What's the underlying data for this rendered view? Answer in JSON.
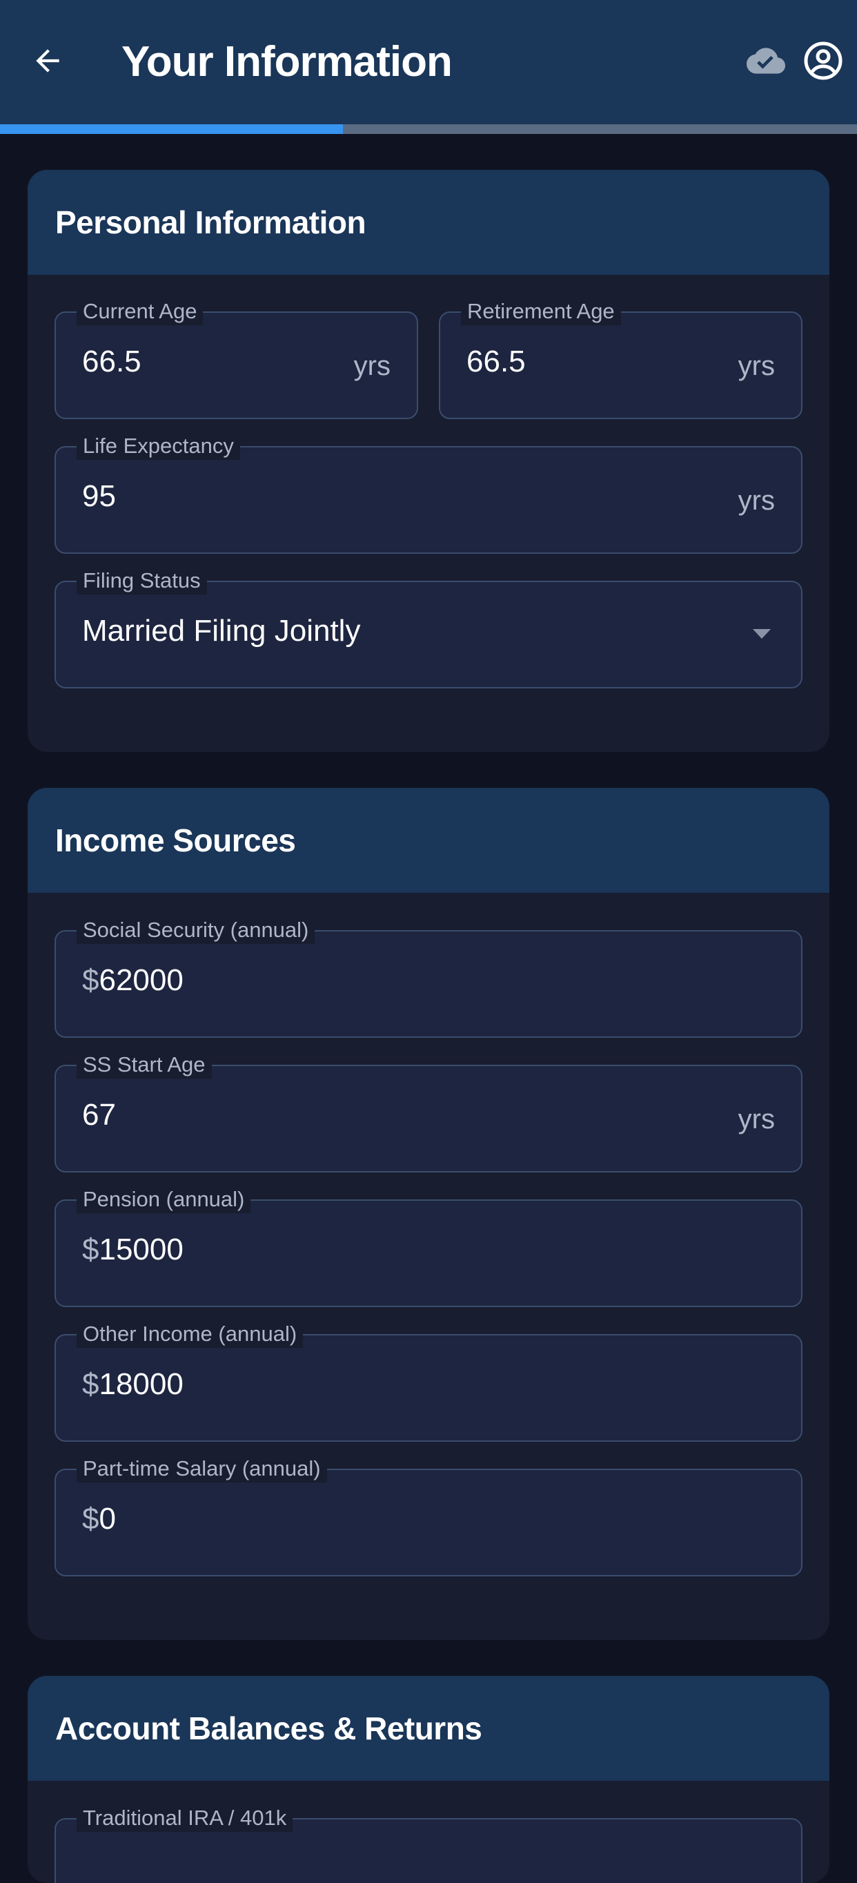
{
  "app": {
    "title": "Your Information",
    "progress_fraction": 0.4
  },
  "personal": {
    "title": "Personal Information",
    "current_age": {
      "label": "Current Age",
      "value": "66.5",
      "suffix": "yrs"
    },
    "retirement_age": {
      "label": "Retirement Age",
      "value": "66.5",
      "suffix": "yrs"
    },
    "life_expectancy": {
      "label": "Life Expectancy",
      "value": "95",
      "suffix": "yrs"
    },
    "filing_status": {
      "label": "Filing Status",
      "value": "Married Filing Jointly"
    }
  },
  "income": {
    "title": "Income Sources",
    "social_security": {
      "label": "Social Security (annual)",
      "prefix": "$",
      "value": "62000"
    },
    "ss_start_age": {
      "label": "SS Start Age",
      "value": "67",
      "suffix": "yrs"
    },
    "pension": {
      "label": "Pension (annual)",
      "prefix": "$",
      "value": "15000"
    },
    "other_income": {
      "label": "Other Income (annual)",
      "prefix": "$",
      "value": "18000"
    },
    "part_time_salary": {
      "label": "Part-time Salary (annual)",
      "prefix": "$",
      "value": "0"
    }
  },
  "accounts": {
    "title": "Account Balances & Returns",
    "traditional_ira": {
      "label": "Traditional IRA / 401k"
    }
  },
  "icons": {
    "back": "arrow-back-icon",
    "cloud": "cloud-done-icon",
    "account": "account-circle-icon",
    "dropdown": "dropdown-arrow-icon"
  },
  "colors": {
    "appbar": "#1a3658",
    "background": "#0f1321",
    "card": "#181d2f",
    "field": "#1e2540",
    "field_border": "#3a4d6d",
    "progress": "#3794f0",
    "progress_track": "#5a6b84",
    "label": "#aeb7c8"
  }
}
